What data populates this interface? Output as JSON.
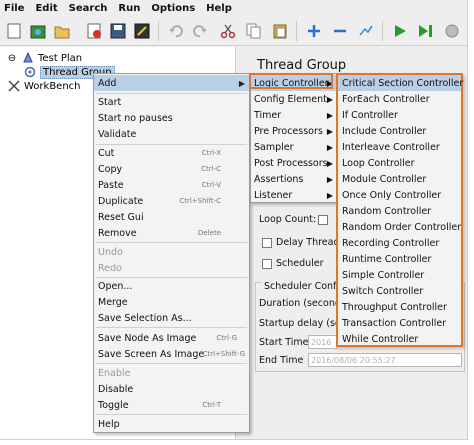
{
  "menubar": {
    "items": [
      "File",
      "Edit",
      "Search",
      "Run",
      "Options",
      "Help"
    ]
  },
  "tree": {
    "test_plan": "Test Plan",
    "thread_group": "Thread Group",
    "workbench": "WorkBench"
  },
  "panel": {
    "title": "Thread Group",
    "loop_count": "Loop Count:",
    "delay_thread": "Delay Thread",
    "scheduler": "Scheduler",
    "scheduler_config": "Scheduler Config",
    "duration": "Duration (second",
    "startup_delay": "Startup delay (se",
    "start_time": "Start Time",
    "start_time_value": "2016",
    "end_time": "End Time",
    "end_time_value": "2016/08/06 20:55:27"
  },
  "context_menu": {
    "add": "Add",
    "start": "Start",
    "start_no_pauses": "Start no pauses",
    "validate": "Validate",
    "cut": "Cut",
    "cut_sc": "Ctrl-X",
    "copy": "Copy",
    "copy_sc": "Ctrl-C",
    "paste": "Paste",
    "paste_sc": "Ctrl-V",
    "duplicate": "Duplicate",
    "duplicate_sc": "Ctrl+Shift-C",
    "reset_gui": "Reset Gui",
    "remove": "Remove",
    "remove_sc": "Delete",
    "undo": "Undo",
    "redo": "Redo",
    "open": "Open...",
    "merge": "Merge",
    "save_selection": "Save Selection As...",
    "save_node_image": "Save Node As Image",
    "save_node_image_sc": "Ctrl-G",
    "save_screen_image": "Save Screen As Image",
    "save_screen_image_sc": "Ctrl+Shift-G",
    "enable": "Enable",
    "disable": "Disable",
    "toggle": "Toggle",
    "toggle_sc": "Ctrl-T",
    "help": "Help"
  },
  "add_submenu": {
    "items": [
      "Logic Controller",
      "Config Element",
      "Timer",
      "Pre Processors",
      "Sampler",
      "Post Processors",
      "Assertions",
      "Listener"
    ]
  },
  "logic_controller_submenu": {
    "items": [
      "Critical Section Controller",
      "ForEach Controller",
      "If Controller",
      "Include Controller",
      "Interleave Controller",
      "Loop Controller",
      "Module Controller",
      "Once Only Controller",
      "Random Controller",
      "Random Order Controller",
      "Recording Controller",
      "Runtime Controller",
      "Simple Controller",
      "Switch Controller",
      "Throughput Controller",
      "Transaction Controller",
      "While Controller"
    ]
  },
  "colors": {
    "highlight_border": "#e0762a",
    "selection": "#b8cfe5"
  }
}
